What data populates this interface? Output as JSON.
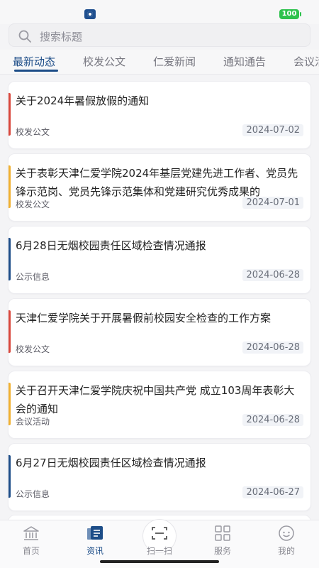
{
  "status_bar": {
    "battery": "100"
  },
  "search": {
    "placeholder": "搜索标题"
  },
  "tabs": [
    {
      "label": "最新动态",
      "active": true
    },
    {
      "label": "校发公文",
      "active": false
    },
    {
      "label": "仁爱新闻",
      "active": false
    },
    {
      "label": "通知通告",
      "active": false
    },
    {
      "label": "会议活",
      "active": false
    }
  ],
  "feed": [
    {
      "title": "关于2024年暑假放假的通知",
      "category": "校发公文",
      "date": "2024-07-02",
      "accent": "#d9473c"
    },
    {
      "title": "关于表彰天津仁爱学院2024年基层党建先进工作者、党员先锋示范岗、党员先锋示范集体和党建研究优秀成果的",
      "category": "校发公文",
      "date": "2024-07-01",
      "accent": "#f0b030"
    },
    {
      "title": "6月28日无烟校园责任区域检查情况通报",
      "category": "公示信息",
      "date": "2024-06-28",
      "accent": "#1d4d88"
    },
    {
      "title": "天津仁爱学院关于开展暑假前校园安全检查的工作方案",
      "category": "校发公文",
      "date": "2024-06-28",
      "accent": "#d9473c"
    },
    {
      "title": "关于召开天津仁爱学院庆祝中国共产党 成立103周年表彰大会的通知",
      "category": "会议活动",
      "date": "2024-06-28",
      "accent": "#f0b030"
    },
    {
      "title": "6月27日无烟校园责任区域检查情况通报",
      "category": "公示信息",
      "date": "2024-06-27",
      "accent": "#1d4d88"
    }
  ],
  "bottom_nav": [
    {
      "label": "首页",
      "icon": "home-icon",
      "active": false
    },
    {
      "label": "资讯",
      "icon": "news-icon",
      "active": true
    },
    {
      "label": "扫一扫",
      "icon": "scan-icon",
      "active": false
    },
    {
      "label": "服务",
      "icon": "grid-icon",
      "active": false
    },
    {
      "label": "我的",
      "icon": "profile-icon",
      "active": false
    }
  ],
  "colors": {
    "accent": "#1d4d88",
    "battery": "#2ec24d"
  }
}
